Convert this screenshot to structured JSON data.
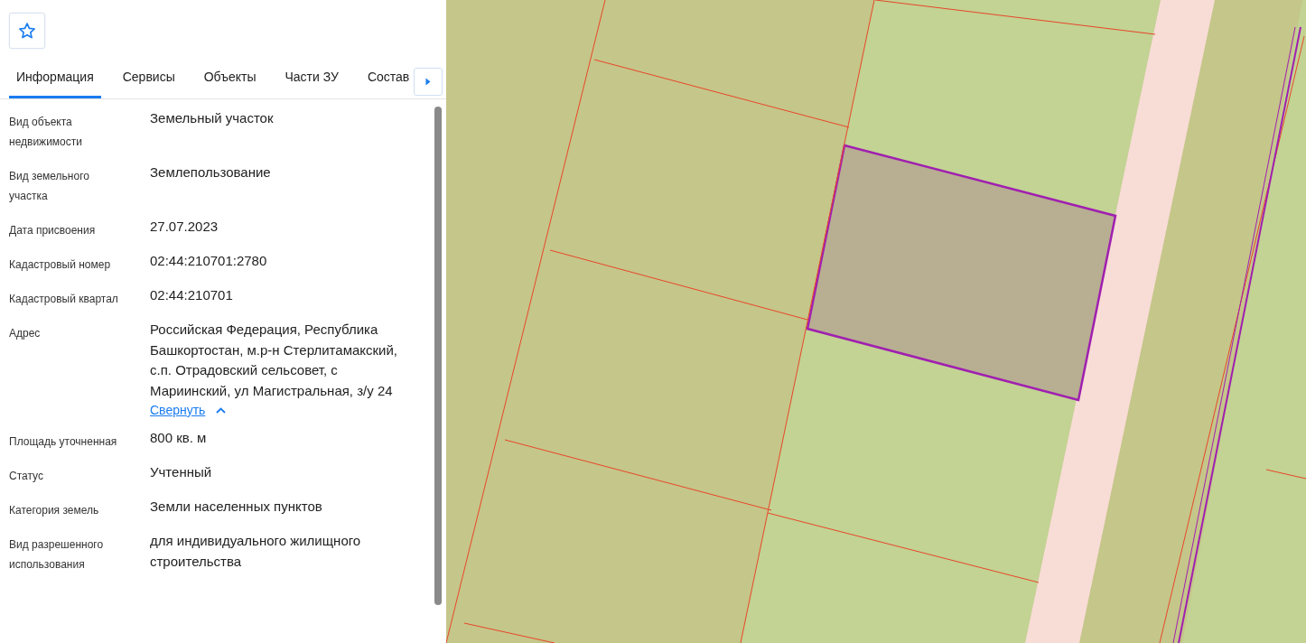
{
  "tabs": [
    {
      "label": "Информация",
      "selected": true
    },
    {
      "label": "Сервисы",
      "selected": false
    },
    {
      "label": "Объекты",
      "selected": false
    },
    {
      "label": "Части ЗУ",
      "selected": false
    },
    {
      "label": "Состав",
      "selected": false
    }
  ],
  "properties": [
    {
      "label": "Вид объекта недвижимости",
      "value": "Земельный участок"
    },
    {
      "label": "Вид земельного участка",
      "value": "Землепользование"
    },
    {
      "label": "Дата присвоения",
      "value": "27.07.2023"
    },
    {
      "label": "Кадастровый номер",
      "value": "02:44:210701:2780"
    },
    {
      "label": "Кадастровый квартал",
      "value": "02:44:210701"
    },
    {
      "label": "Адрес",
      "value": "Российская Федерация, Республика Башкортостан, м.р-н Стерлитамакский, с.п. Отрадовский сельсовет, с Мариинский, ул Магистральная, з/у 24",
      "toggle": {
        "label": "Свернуть",
        "expanded": true
      }
    },
    {
      "label": "Площадь уточненная",
      "value": "800 кв. м"
    },
    {
      "label": "Статус",
      "value": "Учтенный"
    },
    {
      "label": "Категория земель",
      "value": "Земли населенных пунктов"
    },
    {
      "label": "Вид разрешенного использования",
      "value": "для индивидуального жилищного строительства"
    }
  ]
}
